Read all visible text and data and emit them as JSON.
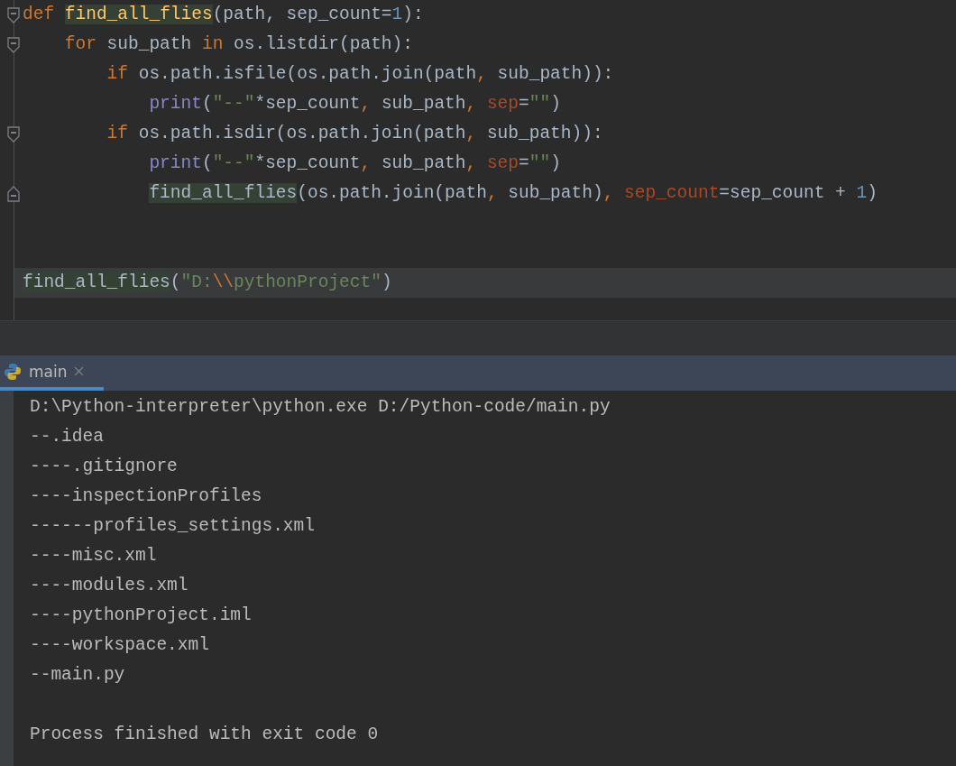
{
  "editor": {
    "lines": [
      {
        "kind": "code",
        "fold_open": true,
        "fold_close": false,
        "current": false,
        "tokens": [
          {
            "kind": "keyword",
            "text": "def "
          },
          {
            "kind": "defname",
            "text": "find_all_flies"
          },
          {
            "kind": "plain",
            "text": "(path, sep_count="
          },
          {
            "kind": "number",
            "text": "1"
          },
          {
            "kind": "plain",
            "text": "):"
          }
        ],
        "children": [
          {
            "kind": "code",
            "fold_open": true,
            "fold_close": false,
            "current": false,
            "tokens": [
              {
                "kind": "keyword",
                "text": "for "
              },
              {
                "kind": "plain",
                "text": "sub_path "
              },
              {
                "kind": "keyword",
                "text": "in "
              },
              {
                "kind": "plain",
                "text": "os.listdir(path):"
              }
            ],
            "children": [
              {
                "kind": "code",
                "fold_open": false,
                "fold_close": false,
                "current": false,
                "tokens": [
                  {
                    "kind": "keyword",
                    "text": "if "
                  },
                  {
                    "kind": "plain",
                    "text": "os.path.isfile(os.path.join(path"
                  },
                  {
                    "kind": "keyword",
                    "text": ", "
                  },
                  {
                    "kind": "plain",
                    "text": "sub_path)):"
                  }
                ],
                "children": [
                  {
                    "kind": "code",
                    "fold_open": false,
                    "fold_close": false,
                    "current": false,
                    "tokens": [
                      {
                        "kind": "builtin",
                        "text": "print"
                      },
                      {
                        "kind": "plain",
                        "text": "("
                      },
                      {
                        "kind": "string",
                        "text": "\"--\""
                      },
                      {
                        "kind": "plain",
                        "text": "*sep_count"
                      },
                      {
                        "kind": "keyword",
                        "text": ", "
                      },
                      {
                        "kind": "plain",
                        "text": "sub_path"
                      },
                      {
                        "kind": "keyword",
                        "text": ", "
                      },
                      {
                        "kind": "param",
                        "text": "sep"
                      },
                      {
                        "kind": "plain",
                        "text": "="
                      },
                      {
                        "kind": "string",
                        "text": "\"\""
                      },
                      {
                        "kind": "plain",
                        "text": ")"
                      }
                    ]
                  }
                ]
              },
              {
                "kind": "code",
                "fold_open": true,
                "fold_close": false,
                "current": false,
                "tokens": [
                  {
                    "kind": "keyword",
                    "text": "if "
                  },
                  {
                    "kind": "plain",
                    "text": "os.path.isdir(os.path.join(path"
                  },
                  {
                    "kind": "keyword",
                    "text": ", "
                  },
                  {
                    "kind": "plain",
                    "text": "sub_path)):"
                  }
                ],
                "children": [
                  {
                    "kind": "code",
                    "fold_open": false,
                    "fold_close": false,
                    "current": false,
                    "tokens": [
                      {
                        "kind": "builtin",
                        "text": "print"
                      },
                      {
                        "kind": "plain",
                        "text": "("
                      },
                      {
                        "kind": "string",
                        "text": "\"--\""
                      },
                      {
                        "kind": "plain",
                        "text": "*sep_count"
                      },
                      {
                        "kind": "keyword",
                        "text": ", "
                      },
                      {
                        "kind": "plain",
                        "text": "sub_path"
                      },
                      {
                        "kind": "keyword",
                        "text": ", "
                      },
                      {
                        "kind": "param",
                        "text": "sep"
                      },
                      {
                        "kind": "plain",
                        "text": "="
                      },
                      {
                        "kind": "string",
                        "text": "\"\""
                      },
                      {
                        "kind": "plain",
                        "text": ")"
                      }
                    ]
                  },
                  {
                    "kind": "code",
                    "fold_open": false,
                    "fold_close": true,
                    "current": false,
                    "tokens": [
                      {
                        "kind": "usage",
                        "text": "find_all_flies"
                      },
                      {
                        "kind": "plain",
                        "text": "(os.path.join(path"
                      },
                      {
                        "kind": "keyword",
                        "text": ", "
                      },
                      {
                        "kind": "plain",
                        "text": "sub_path)"
                      },
                      {
                        "kind": "keyword",
                        "text": ", "
                      },
                      {
                        "kind": "param",
                        "text": "sep_count"
                      },
                      {
                        "kind": "plain",
                        "text": "=sep_count + "
                      },
                      {
                        "kind": "number",
                        "text": "1"
                      },
                      {
                        "kind": "plain",
                        "text": ")"
                      }
                    ]
                  }
                ]
              }
            ]
          }
        ]
      },
      {
        "kind": "blank"
      },
      {
        "kind": "blank"
      },
      {
        "kind": "code",
        "fold_open": false,
        "fold_close": false,
        "current": true,
        "tokens": [
          {
            "kind": "usage",
            "text": "find_all_flies"
          },
          {
            "kind": "plain",
            "text": "("
          },
          {
            "kind": "string",
            "text": "\"D:"
          },
          {
            "kind": "escape",
            "text": "\\\\"
          },
          {
            "kind": "string",
            "text": "pythonProject\""
          },
          {
            "kind": "plain",
            "text": ")"
          }
        ]
      }
    ]
  },
  "run_panel": {
    "tabs": [
      {
        "label": "main",
        "selected": true
      }
    ],
    "output": [
      {
        "kind": "line",
        "text": "D:\\Python-interpreter\\python.exe D:/Python-code/main.py"
      },
      {
        "kind": "line",
        "text": "--.idea"
      },
      {
        "kind": "line",
        "text": "----.gitignore"
      },
      {
        "kind": "line",
        "text": "----inspectionProfiles"
      },
      {
        "kind": "line",
        "text": "------profiles_settings.xml"
      },
      {
        "kind": "line",
        "text": "----misc.xml"
      },
      {
        "kind": "line",
        "text": "----modules.xml"
      },
      {
        "kind": "line",
        "text": "----pythonProject.iml"
      },
      {
        "kind": "line",
        "text": "----workspace.xml"
      },
      {
        "kind": "line",
        "text": "--main.py"
      },
      {
        "kind": "status",
        "text": "Process finished with exit code 0"
      }
    ]
  }
}
